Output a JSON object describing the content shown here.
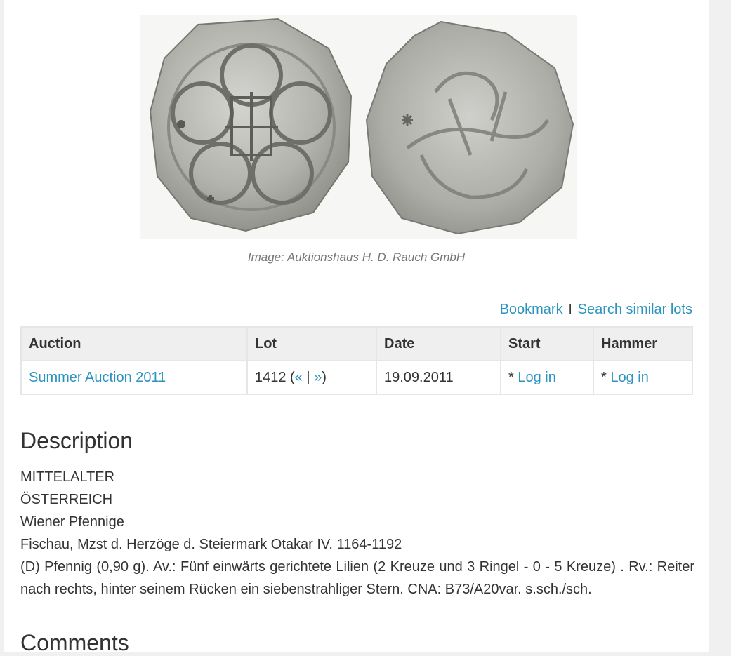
{
  "image": {
    "caption": "Image: Auktionshaus H. D. Rauch GmbH"
  },
  "actions": {
    "bookmark": "Bookmark",
    "separator": "I",
    "search_similar": "Search similar lots"
  },
  "table": {
    "headers": [
      "Auction",
      "Lot",
      "Date",
      "Start",
      "Hammer"
    ],
    "row": {
      "auction": "Summer Auction 2011",
      "lot_number": "1412",
      "lot_open": " (",
      "prev": "«",
      "lot_sep": " | ",
      "next": "»",
      "lot_close": ")",
      "date": "19.09.2011",
      "start_prefix": "* ",
      "start_link": "Log in",
      "hammer_prefix": "* ",
      "hammer_link": "Log in"
    }
  },
  "description": {
    "heading": "Description",
    "lines": [
      "MITTELALTER",
      "ÖSTERREICH",
      "Wiener Pfennige",
      "Fischau, Mzst d. Herzöge d. Steiermark Otakar IV. 1164-1192",
      "(D) Pfennig (0,90 g). Av.: Fünf einwärts gerichtete Lilien (2 Kreuze und 3 Ringel - 0 - 5 Kreuze) . Rv.: Reiter nach rechts, hinter seinem Rücken ein siebenstrahliger Stern. CNA: B73/A20var. s.sch./sch."
    ]
  },
  "comments": {
    "heading": "Comments"
  },
  "colors": {
    "link": "#2a93c0",
    "table_header_bg": "#efefef",
    "coin_silver": "#b3b3ae"
  }
}
